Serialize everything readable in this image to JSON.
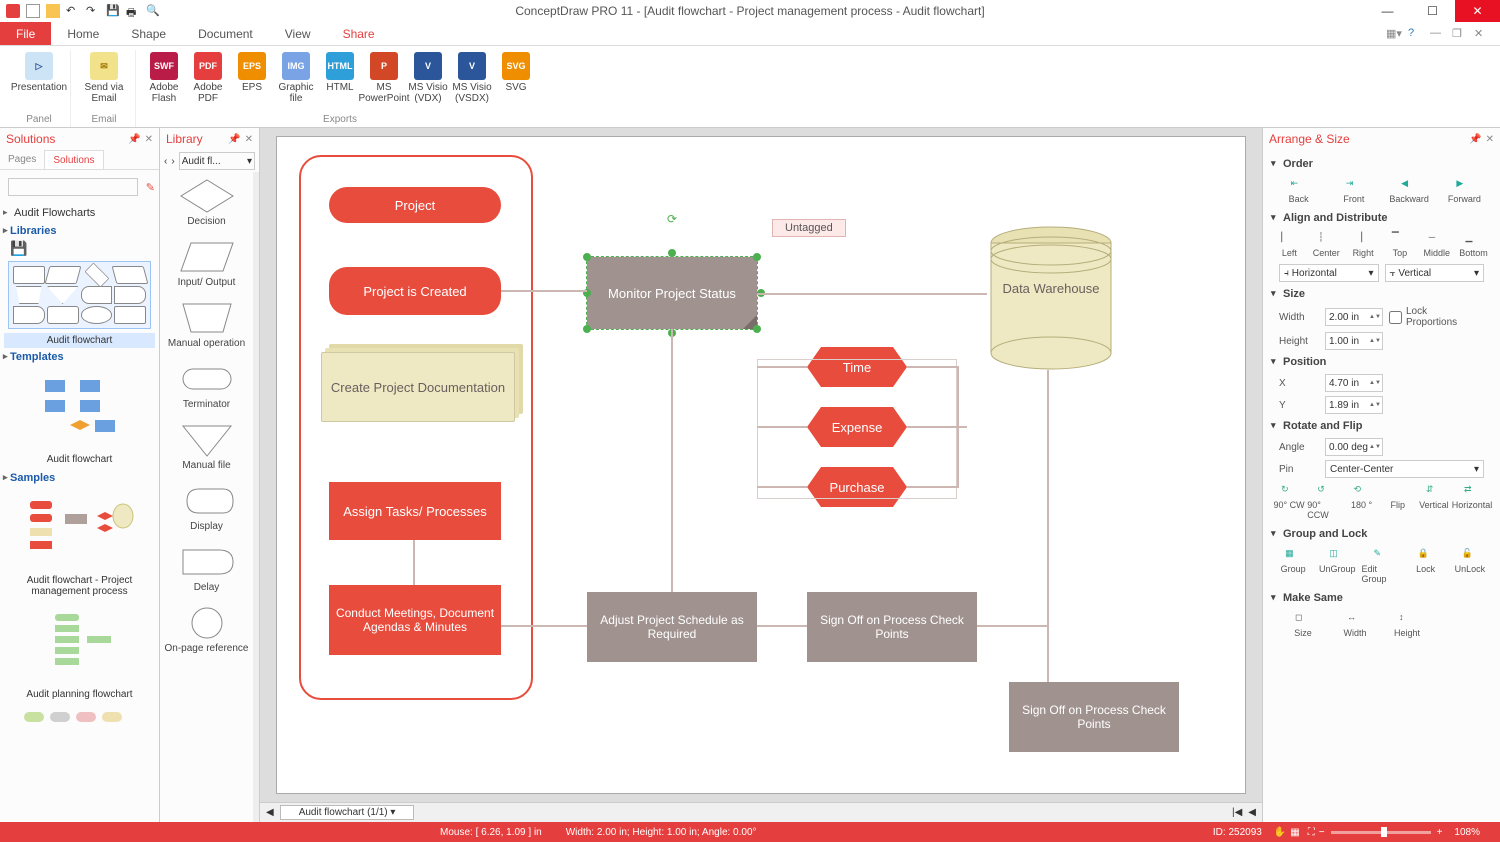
{
  "app": {
    "title": "ConceptDraw PRO 11 - [Audit flowchart - Project management process - Audit flowchart]"
  },
  "menu": {
    "file": "File",
    "tabs": [
      "Home",
      "Shape",
      "Document",
      "View",
      "Share"
    ],
    "active": "Share"
  },
  "ribbon": {
    "panel": {
      "label": "Panel",
      "items": [
        {
          "label": "Presentation"
        }
      ]
    },
    "email": {
      "label": "Email",
      "items": [
        {
          "label": "Send via Email"
        }
      ]
    },
    "exports": {
      "label": "Exports",
      "items": [
        {
          "label": "Adobe Flash",
          "badge": "SWF",
          "color": "#b91d47"
        },
        {
          "label": "Adobe PDF",
          "badge": "PDF",
          "color": "#e53e3e"
        },
        {
          "label": "EPS",
          "badge": "EPS",
          "color": "#ef8e00"
        },
        {
          "label": "Graphic file",
          "badge": "IMG",
          "color": "#7aa3e5"
        },
        {
          "label": "HTML",
          "badge": "HTML",
          "color": "#2e9fd9"
        },
        {
          "label": "MS PowerPoint",
          "badge": "P",
          "color": "#d24726"
        },
        {
          "label": "MS Visio (VDX)",
          "badge": "V",
          "color": "#2b579a"
        },
        {
          "label": "MS Visio (VSDX)",
          "badge": "V",
          "color": "#2b579a"
        },
        {
          "label": "SVG",
          "badge": "SVG",
          "color": "#ef8e00"
        }
      ]
    }
  },
  "solutions": {
    "title": "Solutions",
    "tabs": {
      "pages": "Pages",
      "solutions": "Solutions"
    },
    "tree": {
      "root": "Audit Flowcharts",
      "sections": {
        "libraries": "Libraries",
        "lib_item": "Audit flowchart",
        "templates": "Templates",
        "tmpl_item": "Audit flowchart",
        "samples": "Samples",
        "sample1": "Audit flowchart - Project management process",
        "sample2": "Audit planning flowchart"
      }
    }
  },
  "library": {
    "title": "Library",
    "combo": "Audit fl...",
    "shapes": [
      "Decision",
      "Input/ Output",
      "Manual operation",
      "Terminator",
      "Manual file",
      "Display",
      "Delay",
      "On-page reference"
    ]
  },
  "canvas": {
    "tag_label": "Untagged",
    "shapes": {
      "project": "Project",
      "created": "Project is Created",
      "monitor": "Monitor Project Status",
      "docs": "Create Project Documentation",
      "assign": "Assign Tasks/ Processes",
      "meetings": "Conduct Meetings, Document Agendas & Minutes",
      "adjust": "Adjust Project Schedule as Required",
      "signoff1": "Sign Off on Process Check Points",
      "signoff2": "Sign Off on Process Check Points",
      "time": "Time",
      "expense": "Expense",
      "purchase": "Purchase",
      "dw": "Data Warehouse"
    },
    "doc_tab": "Audit flowchart (1/1)"
  },
  "arrange": {
    "title": "Arrange & Size",
    "order": {
      "h": "Order",
      "back": "Back",
      "front": "Front",
      "backward": "Backward",
      "forward": "Forward"
    },
    "align": {
      "h": "Align and Distribute",
      "left": "Left",
      "center": "Center",
      "right": "Right",
      "top": "Top",
      "middle": "Middle",
      "bottom": "Bottom",
      "horiz": "Horizontal",
      "vert": "Vertical"
    },
    "size": {
      "h": "Size",
      "width_l": "Width",
      "width_v": "2.00 in",
      "height_l": "Height",
      "height_v": "1.00 in",
      "lock": "Lock Proportions"
    },
    "position": {
      "h": "Position",
      "x_l": "X",
      "x_v": "4.70 in",
      "y_l": "Y",
      "y_v": "1.89 in"
    },
    "rotate": {
      "h": "Rotate and Flip",
      "angle_l": "Angle",
      "angle_v": "0.00 deg",
      "pin_l": "Pin",
      "pin_v": "Center-Center",
      "cw": "90° CW",
      "ccw": "90° CCW",
      "r180": "180 °",
      "flip": "Flip",
      "v": "Vertical",
      "hz": "Horizontal"
    },
    "group": {
      "h": "Group and Lock",
      "group": "Group",
      "ungroup": "UnGroup",
      "edit": "Edit Group",
      "lock": "Lock",
      "unlock": "UnLock"
    },
    "same": {
      "h": "Make Same",
      "size": "Size",
      "width": "Width",
      "height": "Height"
    }
  },
  "status": {
    "mouse": "Mouse: [ 6.26, 1.09 ] in",
    "dims": "Width: 2.00 in;  Height: 1.00 in;  Angle: 0.00°",
    "id": "ID: 252093",
    "zoom": "108%"
  }
}
